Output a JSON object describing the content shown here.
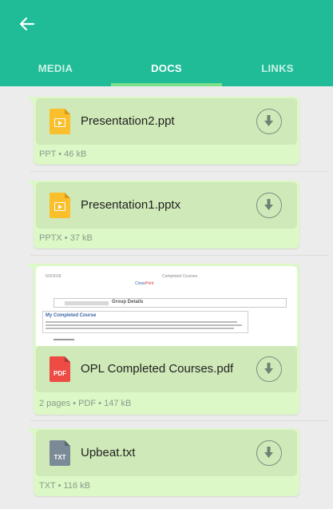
{
  "header": {
    "back_icon": "arrow-left-icon",
    "tabs": [
      {
        "label": "MEDIA",
        "active": false
      },
      {
        "label": "DOCS",
        "active": true
      },
      {
        "label": "LINKS",
        "active": false
      }
    ],
    "colors": {
      "bar": "#20bc98",
      "indicator": "#7be08a"
    }
  },
  "documents": [
    {
      "name": "Presentation2.ppt",
      "icon": "presentation-file-icon",
      "meta": [
        "PPT",
        "46 kB"
      ]
    },
    {
      "name": "Presentation1.pptx",
      "icon": "presentation-file-icon",
      "meta": [
        "PPTX",
        "37 kB"
      ]
    },
    {
      "name": "OPL Completed Courses.pdf",
      "icon": "pdf-file-icon",
      "icon_text": "PDF",
      "meta": [
        "2 pages",
        "PDF",
        "147 kB"
      ],
      "preview": {
        "date": "5/3/2018",
        "title": "Completed Courses",
        "links": [
          "Close",
          "Print"
        ],
        "section": "Group Details",
        "box_heading": "My Completed Course"
      }
    },
    {
      "name": "Upbeat.txt",
      "icon": "txt-file-icon",
      "icon_text": "TXT",
      "meta": [
        "TXT",
        "116 kB"
      ]
    }
  ],
  "bubble_color": "#dcf8c6",
  "download_icon": "download-icon"
}
